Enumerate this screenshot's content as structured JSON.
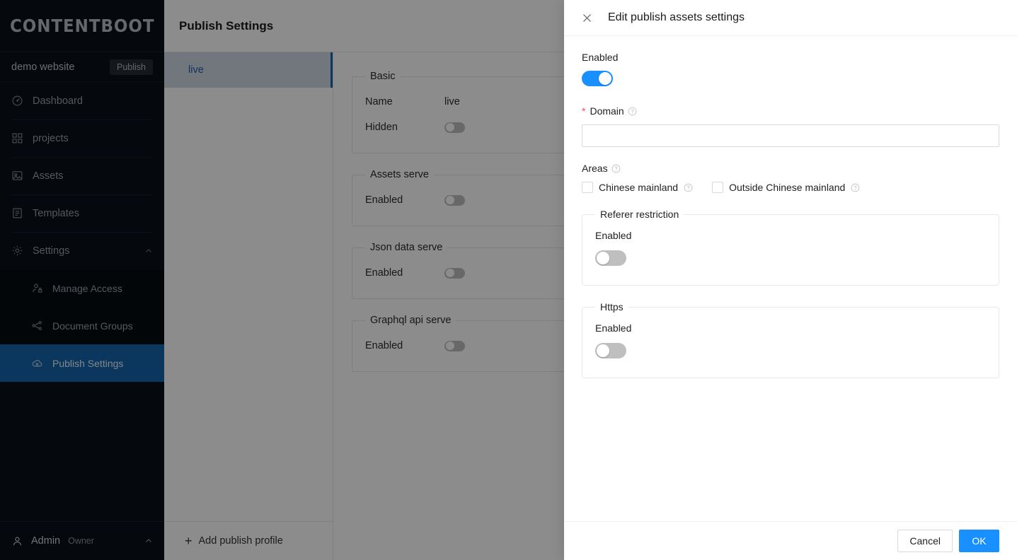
{
  "sidebar": {
    "logo": "CONTENTBOOT",
    "site": {
      "name": "demo website",
      "publish_label": "Publish"
    },
    "items": [
      {
        "label": "Dashboard",
        "icon": "dashboard-icon"
      },
      {
        "label": "projects",
        "icon": "grid-icon"
      },
      {
        "label": "Assets",
        "icon": "image-icon"
      },
      {
        "label": "Templates",
        "icon": "document-icon"
      },
      {
        "label": "Settings",
        "icon": "gear-icon"
      }
    ],
    "sub_items": [
      {
        "label": "Manage Access",
        "icon": "user-lock-icon"
      },
      {
        "label": "Document Groups",
        "icon": "sitemap-icon"
      },
      {
        "label": "Publish Settings",
        "icon": "cloud-eye-icon"
      }
    ],
    "user": {
      "name": "Admin",
      "role": "Owner"
    }
  },
  "main": {
    "title": "Publish Settings",
    "profiles": [
      {
        "label": "live"
      }
    ],
    "add_profile_label": "Add publish profile",
    "sections": [
      {
        "legend": "Basic",
        "rows": [
          {
            "label": "Name",
            "value": "live",
            "type": "text"
          },
          {
            "label": "Hidden",
            "value": "off",
            "type": "toggle"
          }
        ]
      },
      {
        "legend": "Assets serve",
        "rows": [
          {
            "label": "Enabled",
            "value": "off",
            "type": "toggle"
          }
        ]
      },
      {
        "legend": "Json data serve",
        "rows": [
          {
            "label": "Enabled",
            "value": "off",
            "type": "toggle"
          }
        ]
      },
      {
        "legend": "Graphql api serve",
        "rows": [
          {
            "label": "Enabled",
            "value": "off",
            "type": "toggle"
          }
        ]
      }
    ]
  },
  "drawer": {
    "title": "Edit publish assets settings",
    "enabled_label": "Enabled",
    "enabled_state": "on",
    "domain": {
      "label": "Domain",
      "required": true,
      "value": "",
      "placeholder": ""
    },
    "areas": {
      "label": "Areas",
      "options": [
        {
          "label": "Chinese mainland",
          "checked": false
        },
        {
          "label": "Outside Chinese mainland",
          "checked": false
        }
      ]
    },
    "referer": {
      "legend": "Referer restriction",
      "enabled_label": "Enabled",
      "enabled_state": "off"
    },
    "https": {
      "legend": "Https",
      "enabled_label": "Enabled",
      "enabled_state": "off"
    },
    "footer": {
      "cancel_label": "Cancel",
      "ok_label": "OK"
    }
  },
  "colors": {
    "accent_blue": "#1890ff",
    "sidebar_bg": "#0a1017",
    "active_nav": "#1565ad",
    "required_red": "#ff4d4f"
  }
}
